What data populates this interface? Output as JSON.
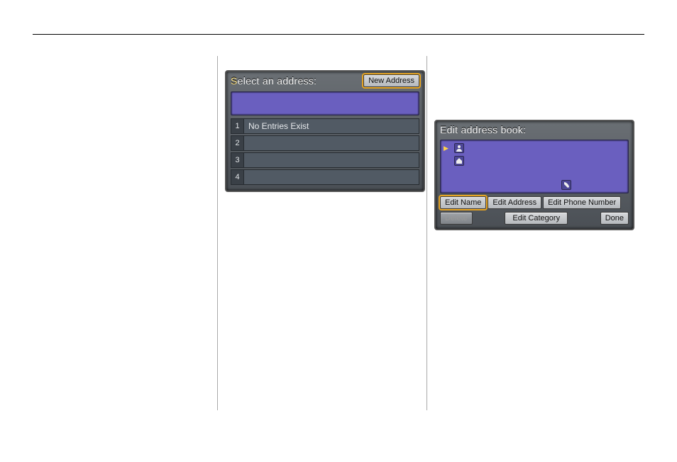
{
  "left_device": {
    "title_prefix_hl": "S",
    "title_rest": "elect an address:",
    "new_address_label": "New Address",
    "rows": [
      {
        "n": "1",
        "text": "No Entries Exist"
      },
      {
        "n": "2",
        "text": ""
      },
      {
        "n": "3",
        "text": ""
      },
      {
        "n": "4",
        "text": ""
      }
    ]
  },
  "right_device": {
    "title": "Edit address book:",
    "icons": {
      "person": "person-icon",
      "home": "home-icon",
      "phone": "phone-icon"
    },
    "edit_name_label": "Edit Name",
    "edit_address_label": "Edit Address",
    "edit_phone_label": "Edit Phone Number",
    "delete_label": "Delete",
    "edit_category_label": "Edit Category",
    "done_label": "Done"
  }
}
